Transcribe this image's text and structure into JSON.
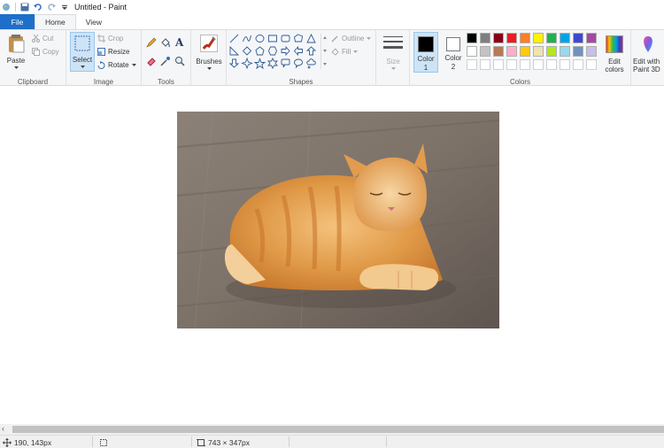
{
  "titlebar": {
    "title": "Untitled - Paint",
    "quick_access": [
      "paint-app-icon",
      "save-icon",
      "undo-icon",
      "redo-icon",
      "customize-dropdown-icon"
    ]
  },
  "tabs": [
    {
      "label": "File"
    },
    {
      "label": "Home"
    },
    {
      "label": "View"
    }
  ],
  "ribbon": {
    "clipboard": {
      "paste": "Paste",
      "cut": "Cut",
      "copy": "Copy",
      "group_label": "Clipboard"
    },
    "image": {
      "select": "Select",
      "crop": "Crop",
      "resize": "Resize",
      "rotate": "Rotate",
      "group_label": "Image"
    },
    "tools": {
      "group_label": "Tools",
      "items": [
        "pencil-icon",
        "fill-bucket-icon",
        "text-icon",
        "eraser-icon",
        "color-picker-icon",
        "magnifier-icon"
      ]
    },
    "brushes": {
      "label": "Brushes"
    },
    "shapes": {
      "group_label": "Shapes",
      "outline": "Outline",
      "fill": "Fill"
    },
    "size": {
      "label": "Size"
    },
    "colors": {
      "color1_line1": "Color",
      "color1_line2": "1",
      "color2_line1": "Color",
      "color2_line2": "2",
      "edit_line1": "Edit",
      "edit_line2": "colors",
      "group_label": "Colors",
      "color1_value": "#000000",
      "color2_value": "#ffffff",
      "palette_row1": [
        "#000000",
        "#7f7f7f",
        "#880015",
        "#ed1c24",
        "#ff7f27",
        "#fff200",
        "#22b14c",
        "#00a2e8",
        "#3f48cc",
        "#a349a4"
      ],
      "palette_row2": [
        "#ffffff",
        "#c3c3c3",
        "#b97a57",
        "#ffaec9",
        "#ffc90e",
        "#efe4b0",
        "#b5e61d",
        "#99d9ea",
        "#7092be",
        "#c8bfe7"
      ],
      "palette_row3": [
        "#ffffff",
        "#ffffff",
        "#ffffff",
        "#ffffff",
        "#ffffff",
        "#ffffff",
        "#ffffff",
        "#ffffff",
        "#ffffff",
        "#ffffff"
      ]
    },
    "paint3d": {
      "line1": "Edit with",
      "line2": "Paint 3D"
    }
  },
  "status": {
    "cursor_position": "190, 143px",
    "image_size": "743 × 347px"
  }
}
